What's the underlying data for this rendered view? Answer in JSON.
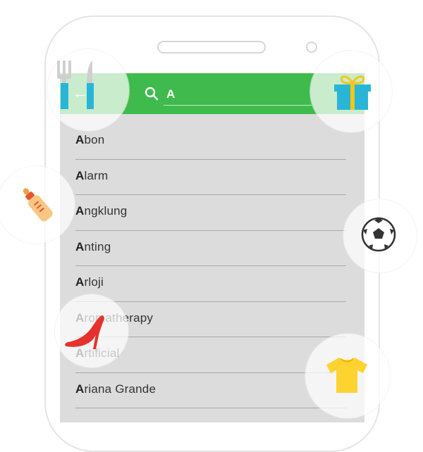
{
  "search": {
    "query": "A"
  },
  "results": [
    {
      "bold": "A",
      "rest": "bon"
    },
    {
      "bold": "A",
      "rest": "larm"
    },
    {
      "bold": "A",
      "rest": "ngklung"
    },
    {
      "bold": "A",
      "rest": "nting"
    },
    {
      "bold": "A",
      "rest": "rloji"
    },
    {
      "bold": "A",
      "rest": "romatherapy"
    },
    {
      "bold": "A",
      "rest": "rtificial"
    },
    {
      "bold": "A",
      "rest": "riana Grande"
    }
  ],
  "icons": {
    "back": "arrow-back-icon",
    "search": "search-icon",
    "cutlery": "cutlery-icon",
    "gift": "gift-icon",
    "baby_bottle": "baby-bottle-icon",
    "soccer_ball": "soccer-ball-icon",
    "high_heel": "high-heel-icon",
    "tshirt": "tshirt-icon"
  },
  "colors": {
    "appbar": "#3fba4c",
    "list_background": "#dcdcdc",
    "gift_box": "#29b6d6",
    "gift_ribbon": "#f5c518",
    "tshirt": "#fdd330",
    "high_heel": "#e5322d",
    "baby_bottle": "#f9c784"
  }
}
